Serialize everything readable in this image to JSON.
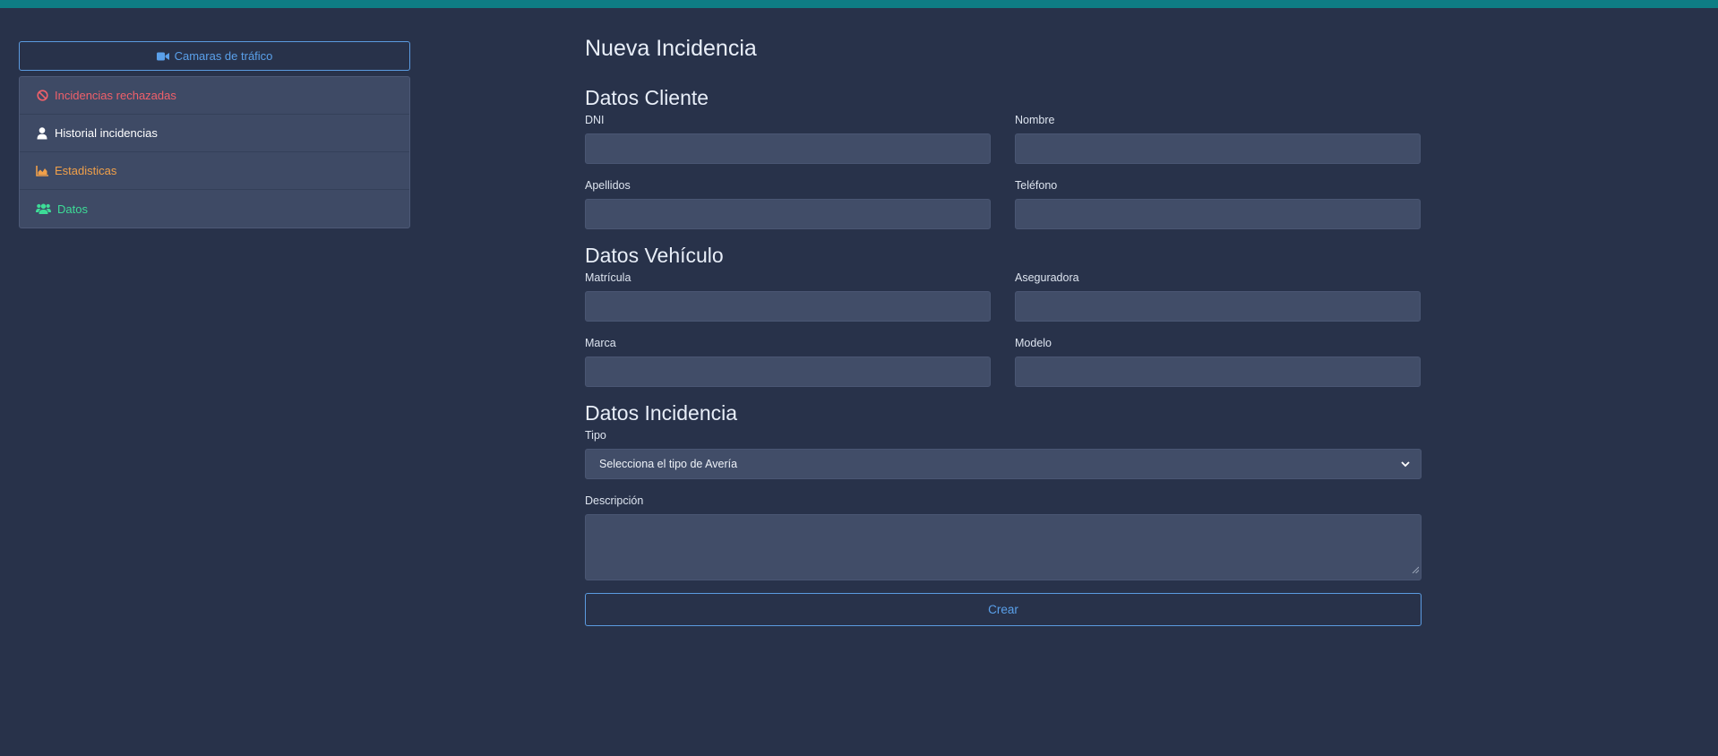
{
  "sidebar": {
    "cameras_button": {
      "label": "Camaras de tráfico",
      "icon": "video-camera-icon",
      "color": "#5aa0ea"
    },
    "items": [
      {
        "label": "Incidencias rechazadas",
        "icon": "ban-icon",
        "color": "#f0606a"
      },
      {
        "label": "Historial incidencias",
        "icon": "user-icon",
        "color": "#ffffff"
      },
      {
        "label": "Estadisticas",
        "icon": "chart-area-icon",
        "color": "#f0a04a"
      },
      {
        "label": "Datos",
        "icon": "users-icon",
        "color": "#3ddc97"
      }
    ]
  },
  "form": {
    "title": "Nueva Incidencia",
    "cliente": {
      "heading": "Datos Cliente",
      "dni": {
        "label": "DNI",
        "value": ""
      },
      "nombre": {
        "label": "Nombre",
        "value": ""
      },
      "apellidos": {
        "label": "Apellidos",
        "value": ""
      },
      "telefono": {
        "label": "Teléfono",
        "value": ""
      }
    },
    "vehiculo": {
      "heading": "Datos Vehículo",
      "matricula": {
        "label": "Matrícula",
        "value": ""
      },
      "aseguradora": {
        "label": "Aseguradora",
        "value": ""
      },
      "marca": {
        "label": "Marca",
        "value": ""
      },
      "modelo": {
        "label": "Modelo",
        "value": ""
      }
    },
    "incidencia": {
      "heading": "Datos Incidencia",
      "tipo": {
        "label": "Tipo",
        "selected": "Selecciona el tipo de Avería"
      },
      "descripcion": {
        "label": "Descripción",
        "value": ""
      }
    },
    "submit_label": "Crear"
  },
  "colors": {
    "background": "#28324a",
    "top_accent": "#0e7d84",
    "input_bg": "#414d68",
    "accent_blue": "#5aa0ea"
  }
}
